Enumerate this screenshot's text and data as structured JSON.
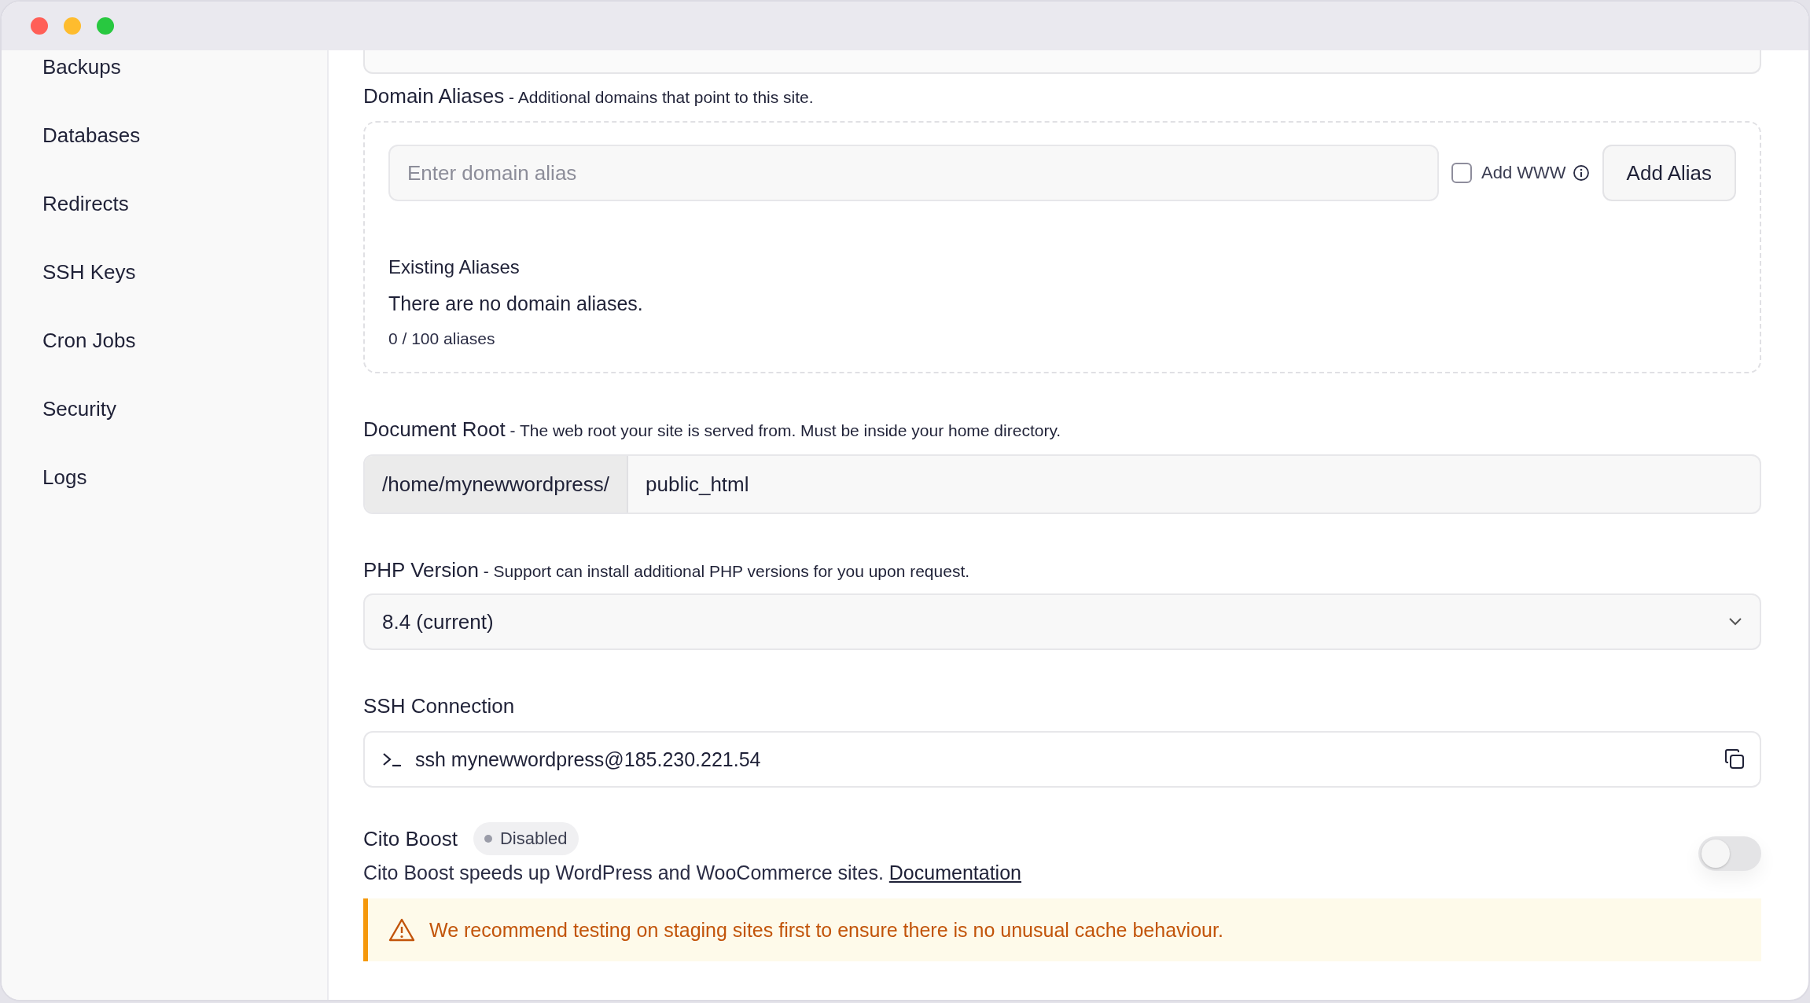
{
  "window": {
    "controls": [
      {
        "color": "#ff5f57"
      },
      {
        "color": "#febc2e"
      },
      {
        "color": "#28c840"
      }
    ]
  },
  "sidebar": {
    "items": [
      {
        "label": "Backups"
      },
      {
        "label": "Databases"
      },
      {
        "label": "Redirects"
      },
      {
        "label": "SSH Keys"
      },
      {
        "label": "Cron Jobs"
      },
      {
        "label": "Security"
      },
      {
        "label": "Logs"
      }
    ]
  },
  "domain_aliases": {
    "title": "Domain Aliases",
    "description": "- Additional domains that point to this site.",
    "input": {
      "placeholder": "Enter domain alias"
    },
    "add_www": {
      "label": "Add WWW",
      "checked": false
    },
    "button": "Add Alias",
    "existing_title": "Existing Aliases",
    "empty_text": "There are no domain aliases.",
    "count": "0 / 100 aliases"
  },
  "document_root": {
    "title": "Document Root",
    "description": "- The web root your site is served from. Must be inside your home directory.",
    "prefix": "/home/mynewwordpress/",
    "value": "public_html"
  },
  "php_version": {
    "title": "PHP Version",
    "description": "- Support can install additional PHP versions for you upon request.",
    "value": "8.4 (current)"
  },
  "ssh_connection": {
    "title": "SSH Connection",
    "command": "ssh mynewwordpress@185.230.221.54"
  },
  "cito_boost": {
    "title": "Cito Boost",
    "status": "Disabled",
    "on": false,
    "description": "Cito Boost speeds up WordPress and WooCommerce sites.",
    "link": "Documentation",
    "warning": "We recommend testing on staging sites first to ensure there is no unusual cache behaviour."
  }
}
